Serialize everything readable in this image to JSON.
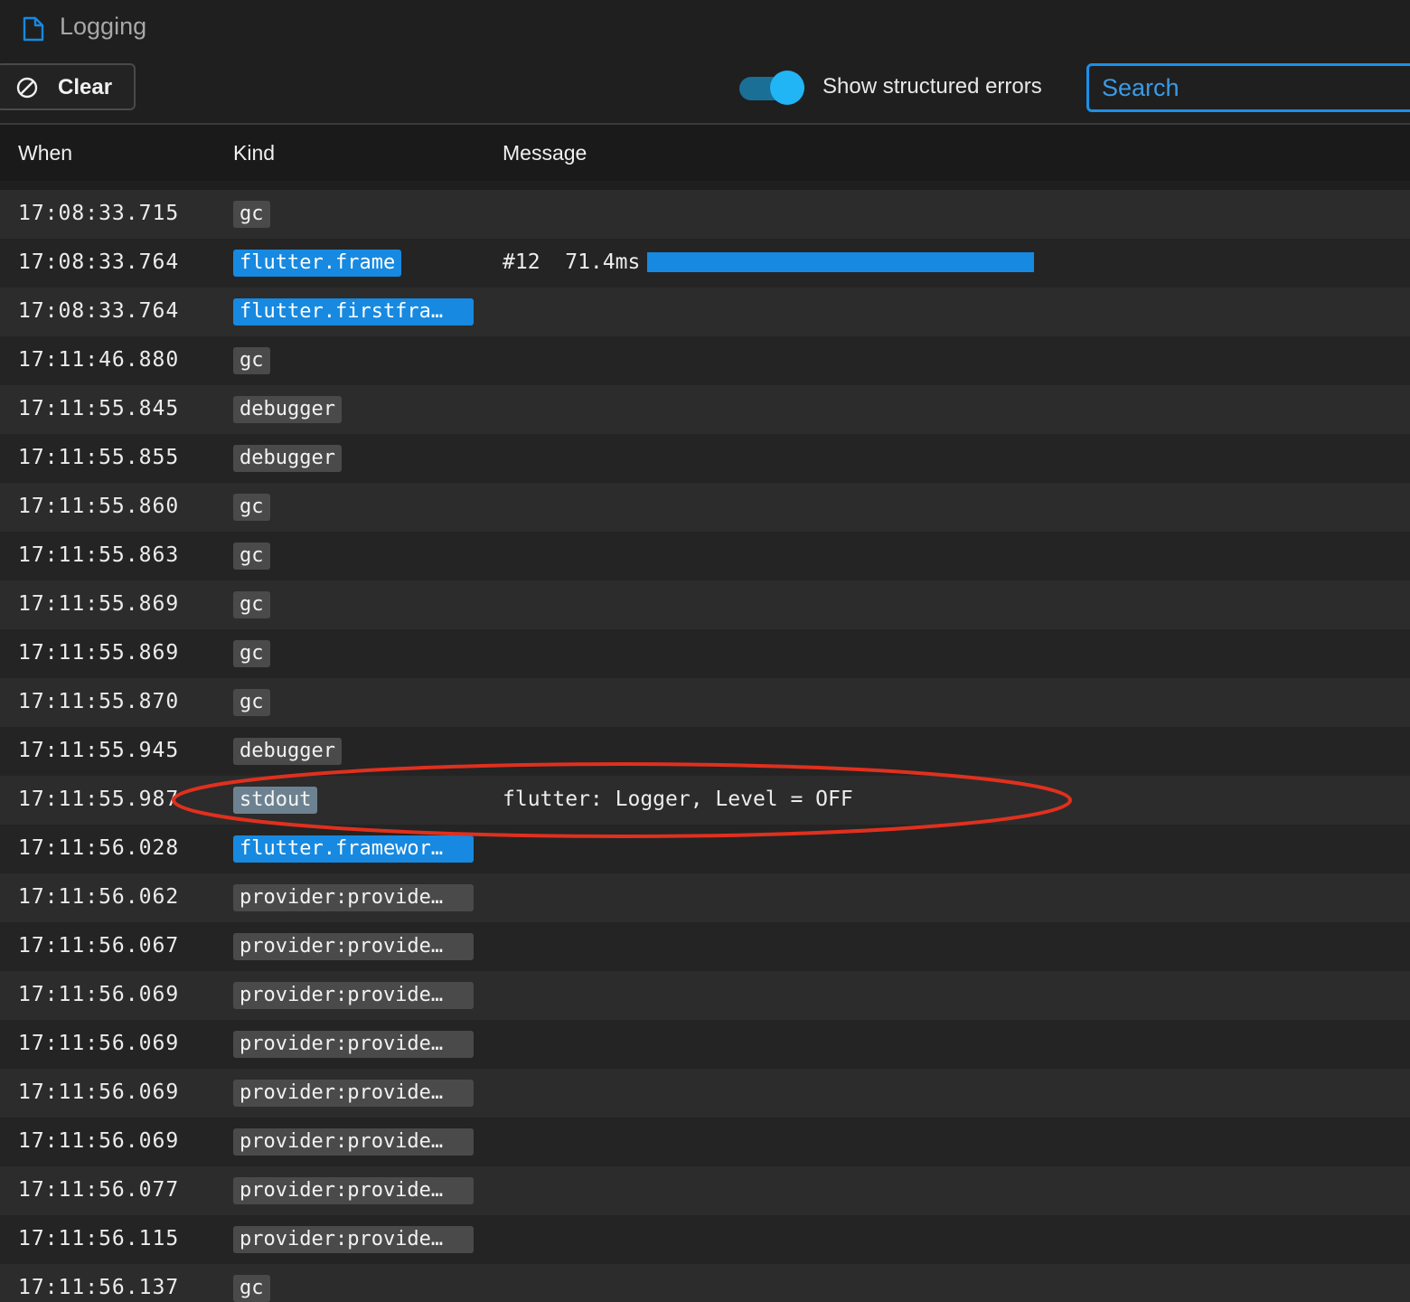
{
  "panel": {
    "title": "Logging",
    "icon": "document-icon"
  },
  "toolbar": {
    "clear_label": "Clear",
    "clear_icon": "block-icon",
    "toggle_label": "Show structured errors",
    "toggle_on": true,
    "search_placeholder": "Search"
  },
  "colors": {
    "accent": "#1789e0",
    "toggle_track": "#1a6f97",
    "toggle_knob": "#21b5f5",
    "annotation": "#e0301e"
  },
  "table": {
    "headers": {
      "when": "When",
      "kind": "Kind",
      "message": "Message"
    },
    "rows": [
      {
        "when": "17:08:33.715",
        "kind": "gc",
        "style": "gray",
        "message": ""
      },
      {
        "when": "17:08:33.764",
        "kind": "flutter.frame",
        "style": "blue",
        "message": "#12  71.4ms",
        "bar_fraction": 1.0
      },
      {
        "when": "17:08:33.764",
        "kind": "flutter.firstfra…",
        "style": "blue",
        "message": ""
      },
      {
        "when": "17:11:46.880",
        "kind": "gc",
        "style": "gray",
        "message": ""
      },
      {
        "when": "17:11:55.845",
        "kind": "debugger",
        "style": "gray",
        "message": ""
      },
      {
        "when": "17:11:55.855",
        "kind": "debugger",
        "style": "gray",
        "message": ""
      },
      {
        "when": "17:11:55.860",
        "kind": "gc",
        "style": "gray",
        "message": ""
      },
      {
        "when": "17:11:55.863",
        "kind": "gc",
        "style": "gray",
        "message": ""
      },
      {
        "when": "17:11:55.869",
        "kind": "gc",
        "style": "gray",
        "message": ""
      },
      {
        "when": "17:11:55.869",
        "kind": "gc",
        "style": "gray",
        "message": ""
      },
      {
        "when": "17:11:55.870",
        "kind": "gc",
        "style": "gray",
        "message": ""
      },
      {
        "when": "17:11:55.945",
        "kind": "debugger",
        "style": "gray",
        "message": ""
      },
      {
        "when": "17:11:55.987",
        "kind": "stdout",
        "style": "stdout",
        "message": "flutter: Logger, Level = OFF",
        "highlighted": true
      },
      {
        "when": "17:11:56.028",
        "kind": "flutter.framewor…",
        "style": "blue",
        "message": ""
      },
      {
        "when": "17:11:56.062",
        "kind": "provider:provide…",
        "style": "gray",
        "message": ""
      },
      {
        "when": "17:11:56.067",
        "kind": "provider:provide…",
        "style": "gray",
        "message": ""
      },
      {
        "when": "17:11:56.069",
        "kind": "provider:provide…",
        "style": "gray",
        "message": ""
      },
      {
        "when": "17:11:56.069",
        "kind": "provider:provide…",
        "style": "gray",
        "message": ""
      },
      {
        "when": "17:11:56.069",
        "kind": "provider:provide…",
        "style": "gray",
        "message": ""
      },
      {
        "when": "17:11:56.069",
        "kind": "provider:provide…",
        "style": "gray",
        "message": ""
      },
      {
        "when": "17:11:56.077",
        "kind": "provider:provide…",
        "style": "gray",
        "message": ""
      },
      {
        "when": "17:11:56.115",
        "kind": "provider:provide…",
        "style": "gray",
        "message": ""
      },
      {
        "when": "17:11:56.137",
        "kind": "gc",
        "style": "gray",
        "message": ""
      }
    ]
  }
}
